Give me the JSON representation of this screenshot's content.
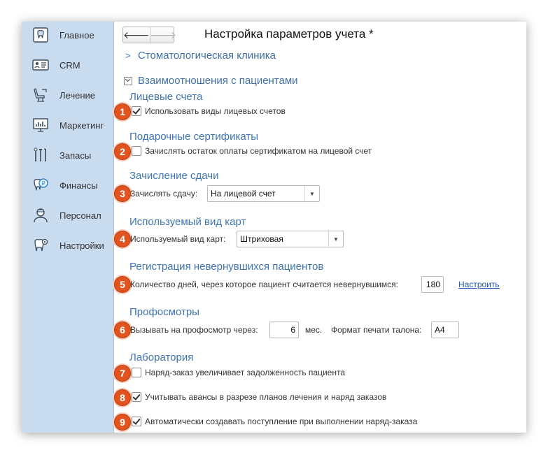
{
  "sidebar": {
    "items": [
      {
        "label": "Главное",
        "icon": "home-tooth-icon"
      },
      {
        "label": "CRM",
        "icon": "crm-card-icon"
      },
      {
        "label": "Лечение",
        "icon": "dental-chair-icon"
      },
      {
        "label": "Маркетинг",
        "icon": "chart-board-icon"
      },
      {
        "label": "Запасы",
        "icon": "dental-tools-icon"
      },
      {
        "label": "Финансы",
        "icon": "tooth-coin-icon"
      },
      {
        "label": "Персонал",
        "icon": "doctor-icon"
      },
      {
        "label": "Настройки",
        "icon": "tooth-gear-icon"
      }
    ]
  },
  "toolbar": {
    "back": "🡐",
    "forward": "🡒"
  },
  "page": {
    "title": "Настройка параметров учета *"
  },
  "groups": {
    "clinic": "Стоматологическая клиника",
    "patients": "Взаимоотношения с пациентами"
  },
  "sections": {
    "accounts": {
      "title": "Лицевые счета",
      "checkbox_label": "Использовать виды лицевых счетов",
      "checked": true,
      "badge": "1"
    },
    "certificates": {
      "title": "Подарочные сертификаты",
      "checkbox_label": "Зачислять остаток оплаты сертификатом на лицевой счет",
      "checked": false,
      "badge": "2"
    },
    "change": {
      "title": "Зачисление сдачи",
      "field_label": "Зачислять сдачу:",
      "value": "На лицевой счет",
      "badge": "3"
    },
    "cards": {
      "title": "Используемый вид карт",
      "field_label": "Используемый вид карт:",
      "value": "Штриховая",
      "badge": "4"
    },
    "nonreturning": {
      "title": "Регистрация невернувшихся пациентов",
      "field_label": "Количество дней, через которое пациент считается невернувшимся:",
      "value": "180",
      "link": "Настроить",
      "badge": "5"
    },
    "checkups": {
      "title": "Профосмотры",
      "field_label": "Вызывать на профосмотр через:",
      "value": "6",
      "unit": "мес.",
      "format_label": "Формат печати талона:",
      "format_value": "A4",
      "badge": "6"
    },
    "lab": {
      "title": "Лаборатория",
      "items": [
        {
          "label": "Наряд-заказ увеличивает задолженность пациента",
          "checked": false,
          "badge": "7"
        },
        {
          "label": "Учитывать авансы в разрезе планов лечения и наряд заказов",
          "checked": true,
          "badge": "8"
        },
        {
          "label": "Автоматически создавать поступление при выполнении наряд-заказа",
          "checked": true,
          "badge": "9"
        }
      ]
    }
  },
  "colors": {
    "sidebar": "#c9dbef",
    "section_title": "#3d74b8",
    "badge": "#e2541f",
    "link": "#2254c2"
  }
}
